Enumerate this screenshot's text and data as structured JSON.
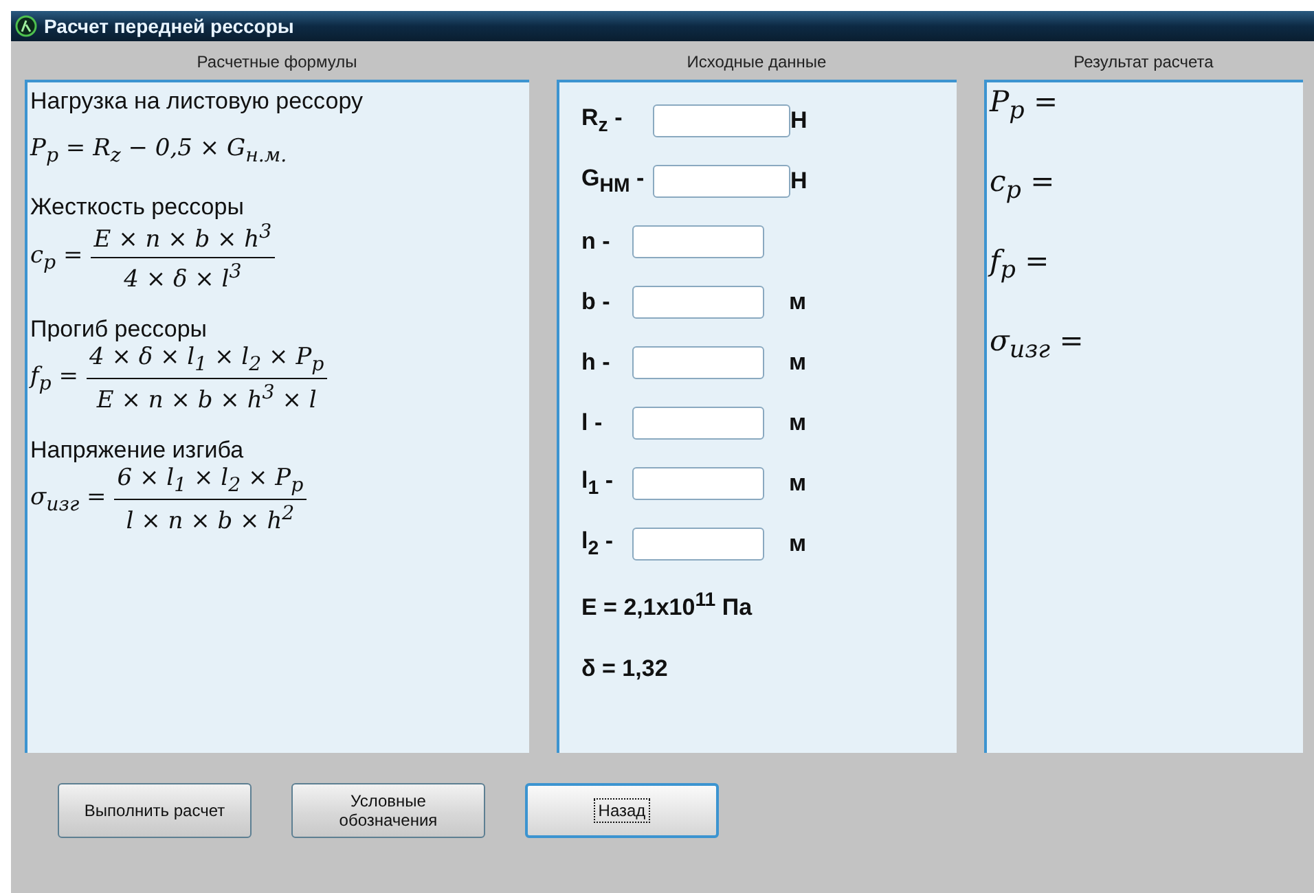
{
  "window": {
    "title": "Расчет передней рессоры"
  },
  "formulas_panel": {
    "header": "Расчетные формулы",
    "sections": [
      {
        "label": "Нагрузка на листовую рессору",
        "kind": "inline",
        "formula": "P$_{p}$ = R$_{z}$ − 0,5 × G$_{н.м.}$"
      },
      {
        "label": "Жесткость рессоры",
        "kind": "fraction",
        "lhs": "c$_{p}$ =",
        "numerator": "E × n × b × h$^{3}$",
        "denominator": "4 × δ × l$^{3}$"
      },
      {
        "label": "Прогиб рессоры",
        "kind": "fraction",
        "lhs": "f$_{p}$ =",
        "numerator": "4 × δ × l$_{1}$ × l$_{2}$ × P$_{p}$",
        "denominator": "E × n × b × h$^{3}$ × l"
      },
      {
        "label": "Напряжение изгиба",
        "kind": "fraction",
        "lhs": "σ$_{изг}$ =",
        "numerator": "6 × l$_{1}$ × l$_{2}$ × P$_{p}$",
        "denominator": "l × n × b × h$^{2}$"
      }
    ]
  },
  "input_panel": {
    "header": "Исходные данные",
    "fields": [
      {
        "label": "R$_{z}$ -",
        "unit": "Н"
      },
      {
        "label": "G$_{НМ}$ -",
        "unit": "Н"
      },
      {
        "label": "n -"
      },
      {
        "label": "b -",
        "unit": "м"
      },
      {
        "label": "h -",
        "unit": "м"
      },
      {
        "label": "l -",
        "unit": "м"
      },
      {
        "label": "l$_{1}$ -",
        "unit": "м"
      },
      {
        "label": "l$_{2}$ -",
        "unit": "м"
      }
    ],
    "constants": [
      "E = 2,1x10$^{11}$ Па",
      "δ = 1,32"
    ]
  },
  "result_panel": {
    "header": "Результат расчета",
    "results": [
      "P$_{p}$ =",
      "c$_{p}$ =",
      "f$_{p}$ =",
      "σ$_{изг}$ ="
    ]
  },
  "buttons": [
    {
      "label": "Выполнить расчет",
      "focused": false
    },
    {
      "label": "Условные обозначения",
      "focused": false
    },
    {
      "label": "Назад",
      "focused": true
    }
  ]
}
